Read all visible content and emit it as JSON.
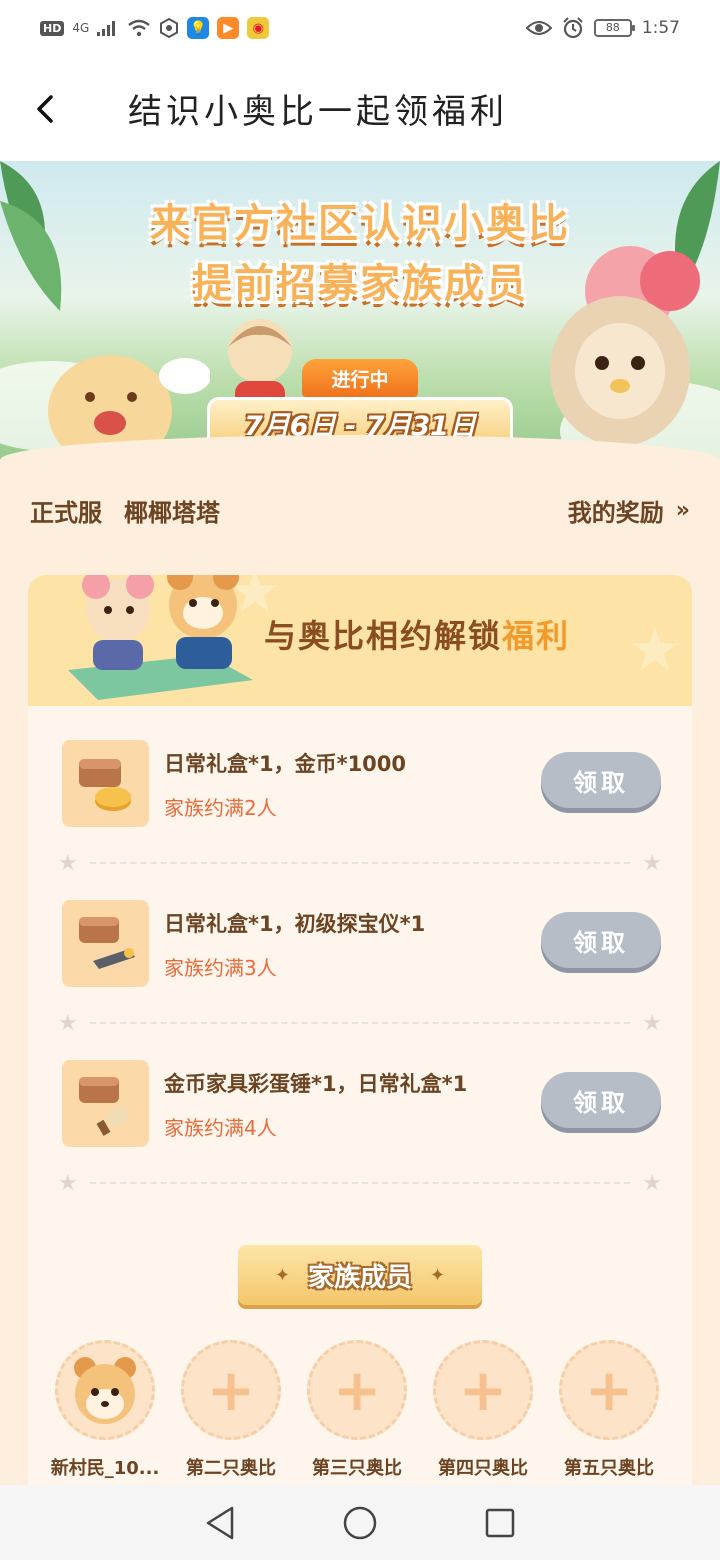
{
  "status_bar": {
    "hd": "HD",
    "network": "4G",
    "battery": "88",
    "time": "1:57"
  },
  "header": {
    "title": "结识小奥比一起领福利"
  },
  "banner": {
    "line1": "来官方社区认识小奥比",
    "line2": "提前招募家族成员",
    "status": "进行中",
    "date_range": "7月6日 - 7月31日"
  },
  "server": {
    "label": "正式服",
    "name": "椰椰塔塔",
    "my_rewards": "我的奖励",
    "chevron": "»"
  },
  "card": {
    "title_prefix": "与奥比相约解锁",
    "title_highlight": "福利",
    "rewards": [
      {
        "name": "日常礼盒*1，金币*1000",
        "condition": "家族约满2人",
        "button": "领取"
      },
      {
        "name": "日常礼盒*1，初级探宝仪*1",
        "condition": "家族约满3人",
        "button": "领取"
      },
      {
        "name": "金币家具彩蛋锤*1，日常礼盒*1",
        "condition": "家族约满4人",
        "button": "领取"
      }
    ]
  },
  "members": {
    "title": "家族成员",
    "list": [
      {
        "name": "新村民_10..."
      },
      {
        "name": "第二只奥比"
      },
      {
        "name": "第三只奥比"
      },
      {
        "name": "第四只奥比"
      },
      {
        "name": "第五只奥比"
      }
    ]
  },
  "colors": {
    "accent_orange": "#f39a2c",
    "condition_red": "#ec6b3b",
    "button_gray": "#b7bdc6",
    "page_bg": "#fdeedd"
  }
}
